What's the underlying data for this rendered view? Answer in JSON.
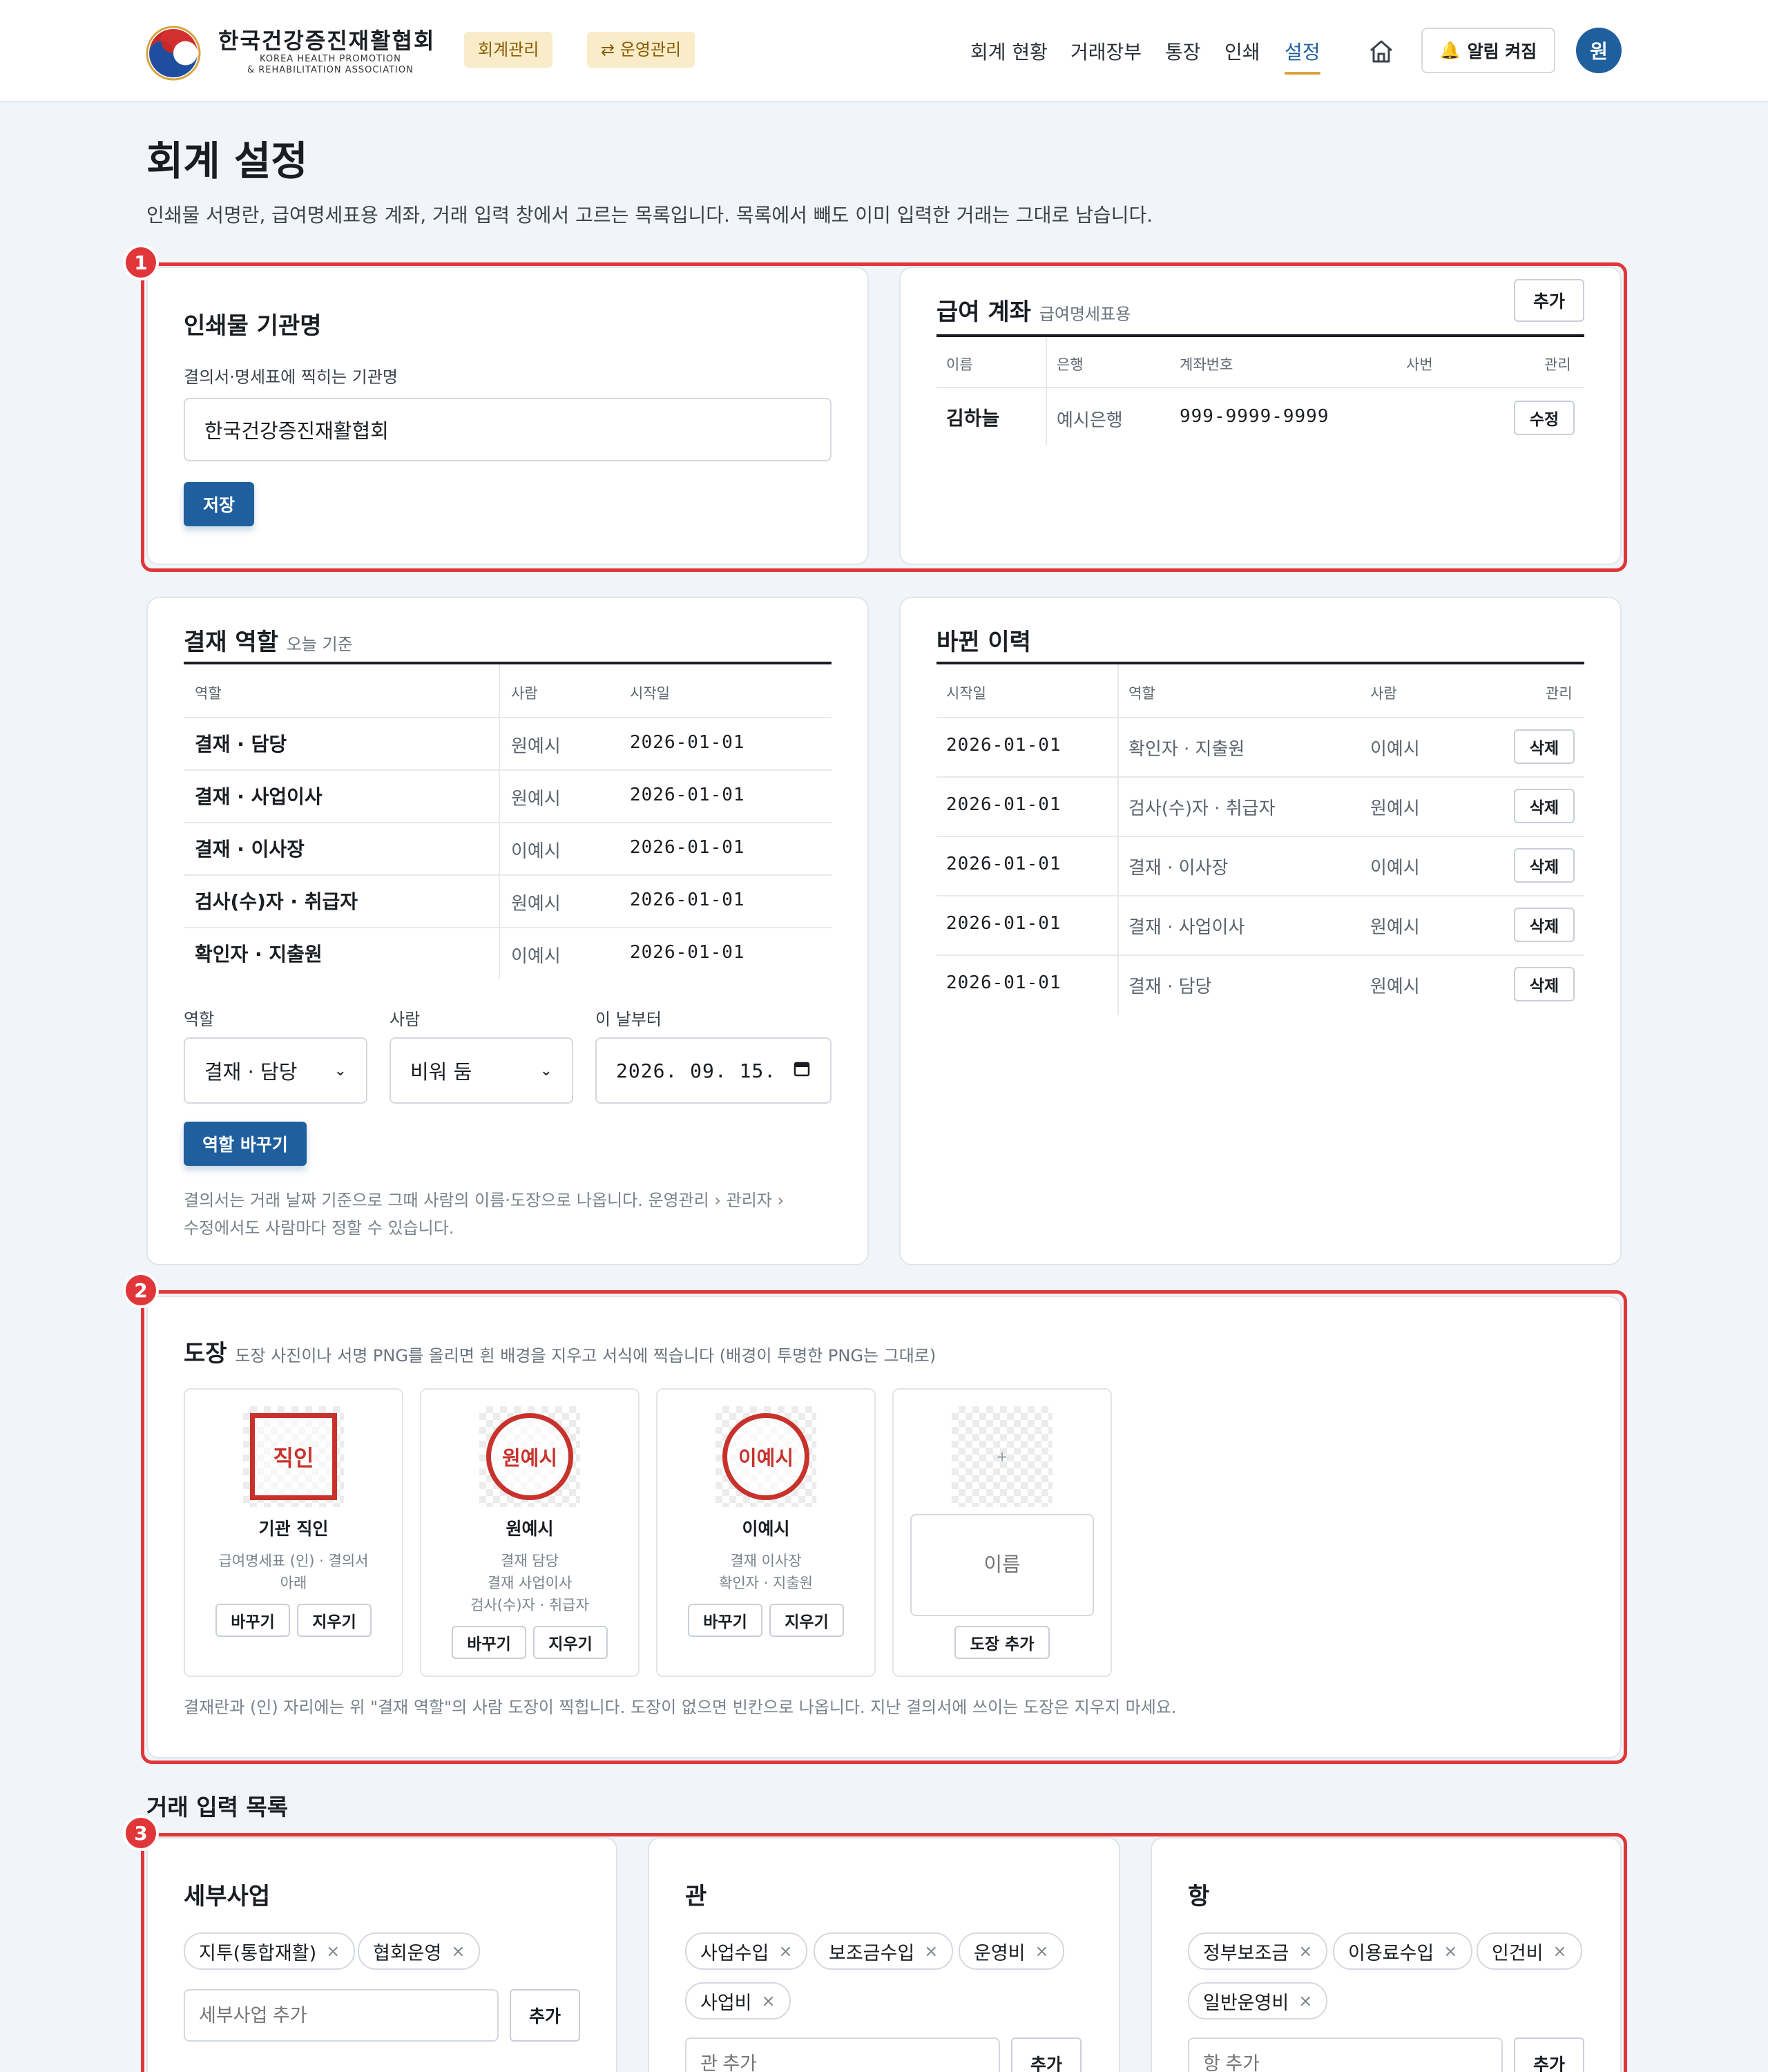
{
  "header": {
    "org_name_ko": "한국건강증진재활협회",
    "org_name_en_1": "KOREA HEALTH PROMOTION",
    "org_name_en_2": "& REHABILITATION ASSOCIATION",
    "pill_accounting": "회계관리",
    "pill_operations": "⇄ 운영관리",
    "nav": [
      "회계 현황",
      "거래장부",
      "통장",
      "인쇄",
      "설정"
    ],
    "active_nav": "설정",
    "alarm_label": "알림 켜짐",
    "avatar_initial": "원"
  },
  "page": {
    "title": "회계 설정",
    "description": "인쇄물 서명란, 급여명세표용 계좌, 거래 입력 창에서 고르는 목록입니다. 목록에서 빼도 이미 입력한 거래는 그대로 남습니다."
  },
  "badges": [
    "1",
    "2",
    "3"
  ],
  "print_org": {
    "title": "인쇄물 기관명",
    "label": "결의서·명세표에 찍히는 기관명",
    "value": "한국건강증진재활협회",
    "save_label": "저장"
  },
  "payroll_account": {
    "title": "급여 계좌",
    "subtitle": "급여명세표용",
    "add_label": "추가",
    "columns": [
      "이름",
      "은행",
      "계좌번호",
      "사번",
      "관리"
    ],
    "rows": [
      {
        "name": "김하늘",
        "bank": "예시은행",
        "account": "999-9999-9999",
        "emp_no": "",
        "action": "수정"
      }
    ]
  },
  "approval_roles": {
    "title": "결재 역할",
    "subtitle": "오늘 기준",
    "columns": [
      "역할",
      "사람",
      "시작일"
    ],
    "rows": [
      {
        "role": "결재 · 담당",
        "person": "원예시",
        "start": "2026-01-01"
      },
      {
        "role": "결재 · 사업이사",
        "person": "원예시",
        "start": "2026-01-01"
      },
      {
        "role": "결재 · 이사장",
        "person": "이예시",
        "start": "2026-01-01"
      },
      {
        "role": "검사(수)자 · 취급자",
        "person": "원예시",
        "start": "2026-01-01"
      },
      {
        "role": "확인자 · 지출원",
        "person": "이예시",
        "start": "2026-01-01"
      }
    ],
    "form": {
      "role_label": "역할",
      "role_value": "결재 · 담당",
      "person_label": "사람",
      "person_value": "비워 둠",
      "date_label": "이 날부터",
      "date_value": "2026. 09. 15.",
      "submit_label": "역할 바꾸기"
    },
    "note_line1": "결의서는 거래 날짜 기준으로 그때 사람의 이름·도장으로 나옵니다. 운영관리 › 관리자 ›",
    "note_line2": "수정에서도 사람마다 정할 수 있습니다."
  },
  "change_history": {
    "title": "바뀐 이력",
    "columns": [
      "시작일",
      "역할",
      "사람",
      "관리"
    ],
    "rows": [
      {
        "start": "2026-01-01",
        "role": "확인자 · 지출원",
        "person": "이예시",
        "action": "삭제"
      },
      {
        "start": "2026-01-01",
        "role": "검사(수)자 · 취급자",
        "person": "원예시",
        "action": "삭제"
      },
      {
        "start": "2026-01-01",
        "role": "결재 · 이사장",
        "person": "이예시",
        "action": "삭제"
      },
      {
        "start": "2026-01-01",
        "role": "결재 · 사업이사",
        "person": "원예시",
        "action": "삭제"
      },
      {
        "start": "2026-01-01",
        "role": "결재 · 담당",
        "person": "원예시",
        "action": "삭제"
      }
    ]
  },
  "stamps": {
    "title": "도장",
    "subtitle": "도장 사진이나 서명 PNG를 올리면 흰 배경을 지우고 서식에 찍습니다 (배경이 투명한 PNG는 그대로)",
    "items": [
      {
        "mark": "직인",
        "name": "기관 직인",
        "roles": [
          "급여명세표 (인) · 결의서",
          "아래"
        ],
        "replace": "바꾸기",
        "clear": "지우기"
      },
      {
        "mark": "원예시",
        "name": "원예시",
        "roles": [
          "결재 담당",
          "결재 사업이사",
          "검사(수)자 · 취급자"
        ],
        "replace": "바꾸기",
        "clear": "지우기"
      },
      {
        "mark": "이예시",
        "name": "이예시",
        "roles": [
          "결재 이사장",
          "확인자 · 지출원"
        ],
        "replace": "바꾸기",
        "clear": "지우기"
      }
    ],
    "new_plus": "+",
    "new_name_placeholder": "이름",
    "add_stamp_label": "도장 추가",
    "note": "결재란과 (인) 자리에는 위 \"결재 역할\"의 사람 도장이 찍힙니다. 도장이 없으면 빈칸으로 나옵니다. 지난 결의서에 쓰이는 도장은 지우지 마세요.",
    "stamp_color": "#c8322c"
  },
  "entry_lists": {
    "title": "거래 입력 목록",
    "groups": [
      {
        "title": "세부사업",
        "chips": [
          "지투(통합재활)",
          "협회운영"
        ],
        "placeholder": "세부사업 추가",
        "add": "추가"
      },
      {
        "title": "관",
        "chips": [
          "사업수입",
          "보조금수입",
          "운영비",
          "사업비"
        ],
        "placeholder": "관 추가",
        "add": "추가"
      },
      {
        "title": "항",
        "chips": [
          "정부보조금",
          "이용료수입",
          "인건비",
          "일반운영비"
        ],
        "placeholder": "항 추가",
        "add": "추가"
      }
    ],
    "remove_glyph": "×"
  },
  "colors": {
    "accent": "#1f5f9e",
    "highlight": "#e0363a",
    "pill_bg": "#f8ecc9",
    "nav_underline": "#d9a23c"
  }
}
